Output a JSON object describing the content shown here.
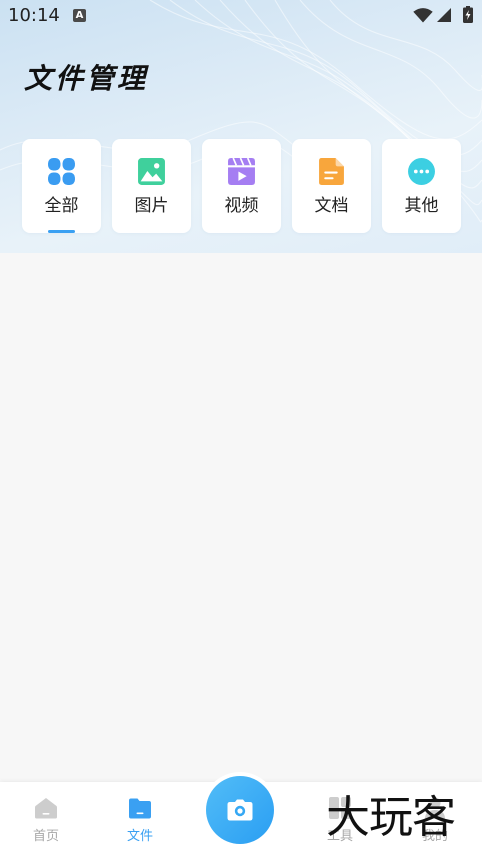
{
  "status_bar": {
    "time": "10:14",
    "notification_badge": "A",
    "icons": [
      "a-icon",
      "wifi-icon",
      "signal-icon",
      "battery-charging-icon"
    ]
  },
  "header": {
    "title": "文件管理"
  },
  "categories": [
    {
      "label": "全部",
      "icon": "grid-icon",
      "color": "#3a9cf1",
      "active": true
    },
    {
      "label": "图片",
      "icon": "image-icon",
      "color": "#3fd09c",
      "active": false
    },
    {
      "label": "视频",
      "icon": "video-icon",
      "color": "#a57ef2",
      "active": false
    },
    {
      "label": "文档",
      "icon": "document-icon",
      "color": "#f8a63c",
      "active": false
    },
    {
      "label": "其他",
      "icon": "more-icon",
      "color": "#3ccfe2",
      "active": false
    }
  ],
  "bottom_nav": {
    "items": [
      {
        "label": "首页",
        "icon": "home-icon",
        "active": false
      },
      {
        "label": "文件",
        "icon": "folder-icon",
        "active": true
      },
      {
        "label": "工具",
        "icon": "tools-icon",
        "active": false
      },
      {
        "label": "我的",
        "icon": "user-icon",
        "active": false
      }
    ],
    "center_button": {
      "icon": "camera-icon"
    }
  },
  "watermark": {
    "text": "大玩客"
  },
  "colors": {
    "accent": "#3aa0f2",
    "inactive": "#a8a8a8",
    "content_background": "#f7f7f7"
  }
}
